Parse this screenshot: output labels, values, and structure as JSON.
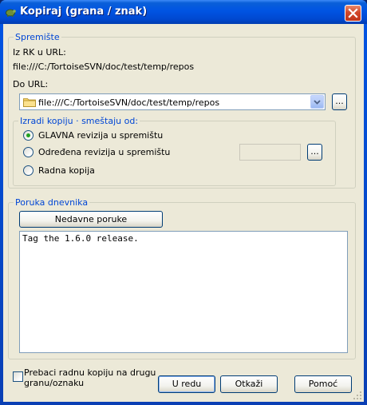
{
  "window": {
    "title": "Kopiraj (grana / znak)"
  },
  "repository": {
    "legend": "Spremište",
    "from_label": "Iz RK u URL:",
    "from_url": "file:///C:/TortoiseSVN/doc/test/temp/repos",
    "to_label": "Do URL:",
    "to_url": "file:///C:/TortoiseSVN/doc/test/temp/repos",
    "browse_label": "..."
  },
  "copy_from": {
    "legend": "Izradi kopiju · smeštaju od:",
    "options": [
      {
        "label": "GLAVNA revizija u spremištu",
        "selected": true
      },
      {
        "label": "Određena revizija u spremištu",
        "selected": false
      },
      {
        "label": "Radna kopija",
        "selected": false
      }
    ],
    "revision_value": "",
    "browse_label": "..."
  },
  "log": {
    "legend": "Poruka dnevnika",
    "recent_button": "Nedavne poruke",
    "message": "Tag the 1.6.0 release."
  },
  "footer": {
    "switch_checkbox_line1": "Prebaci radnu kopiju na drugu",
    "switch_checkbox_line2": "granu/oznaku",
    "switch_checked": false,
    "ok_button": "U redu",
    "cancel_button": "Otkaži",
    "help_button": "Pomoć"
  }
}
